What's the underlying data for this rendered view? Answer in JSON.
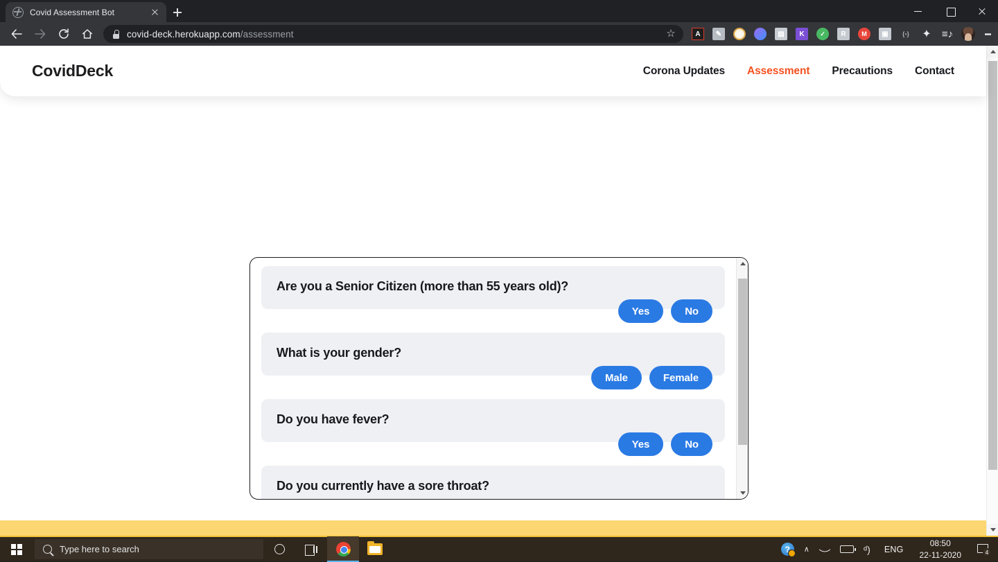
{
  "browser": {
    "tab": {
      "title": "Covid Assessment Bot",
      "favicon": "globe-icon",
      "close": "×"
    },
    "newtab_label": "+",
    "window_controls": {
      "minimize": "–",
      "maximize": "▢",
      "close": "×"
    },
    "nav": {
      "back": "←",
      "forward": "→",
      "reload": "⟳",
      "home": "⌂"
    },
    "address": {
      "lock": "lock-icon",
      "domain": "covid-deck.herokuapp.com",
      "path": "/assessment",
      "bookmark": "☆"
    },
    "extensions": [
      {
        "name": "adobe-acrobat-extension",
        "glyph": "Ʒ"
      },
      {
        "name": "screenshot-extension",
        "glyph": "✐"
      },
      {
        "name": "coin-extension",
        "glyph": "◎"
      },
      {
        "name": "shield-extension",
        "glyph": ""
      },
      {
        "name": "clipboard-extension",
        "glyph": "⎘"
      },
      {
        "name": "kaspersky-extension",
        "glyph": "K"
      },
      {
        "name": "adguard-extension",
        "glyph": "✓"
      },
      {
        "name": "grammar-extension",
        "glyph": "R"
      },
      {
        "name": "mailtrack-extension",
        "glyph": "M"
      },
      {
        "name": "camera-extension",
        "glyph": "▣"
      },
      {
        "name": "code-extension",
        "glyph": "{▫}"
      },
      {
        "name": "puzzle-extensions-icon",
        "glyph": "❖"
      },
      {
        "name": "reading-list-icon",
        "glyph": "≣"
      },
      {
        "name": "profile-avatar",
        "glyph": ""
      }
    ],
    "menu_label": "⋮"
  },
  "site": {
    "brand": "CovidDeck",
    "nav": [
      {
        "label": "Corona Updates",
        "active": false
      },
      {
        "label": "Assessment",
        "active": true
      },
      {
        "label": "Precautions",
        "active": false
      },
      {
        "label": "Contact",
        "active": false
      }
    ],
    "accent_color": "#f4511e",
    "button_color": "#2a7ae4",
    "bubble_color": "#eef0f4",
    "footer_band_color": "#fcd670"
  },
  "assessment": {
    "questions": [
      {
        "text": "Are you a Senior Citizen (more than 55 years old)?",
        "options": [
          "Yes",
          "No"
        ]
      },
      {
        "text": "What is your gender?",
        "options": [
          "Male",
          "Female"
        ]
      },
      {
        "text": "Do you have fever?",
        "options": [
          "Yes",
          "No"
        ]
      },
      {
        "text": "Do you currently have a sore throat?",
        "options": []
      }
    ]
  },
  "taskbar": {
    "start": "windows-logo",
    "search_placeholder": "Type here to search",
    "cortana": "cortana-icon",
    "task_view": "task-view-icon",
    "apps": [
      {
        "name": "chrome-taskbar-icon",
        "active": true
      },
      {
        "name": "file-explorer-taskbar-icon",
        "active": false
      }
    ],
    "tray": {
      "help": "?",
      "chevron": "∧",
      "wifi": "wifi-icon",
      "battery": "battery-icon",
      "volume": "ᵈ)",
      "language": "ENG",
      "time": "08:50",
      "date": "22-11-2020",
      "notification_count": "4"
    }
  }
}
